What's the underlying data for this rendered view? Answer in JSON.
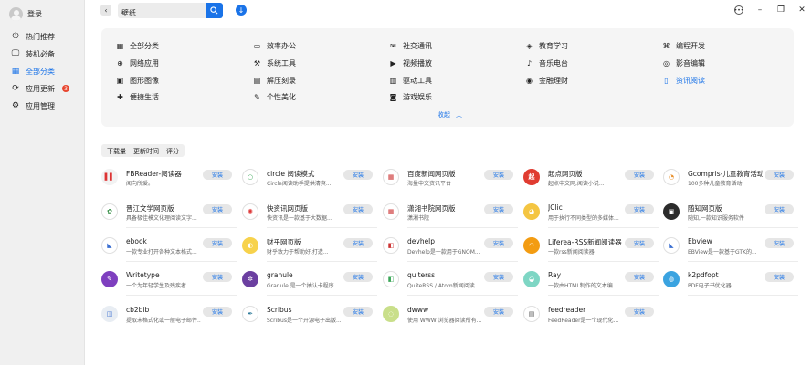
{
  "user": {
    "name": "登录"
  },
  "nav": [
    {
      "label": "热门推荐",
      "icon": "power-icon",
      "glyph": "⏻"
    },
    {
      "label": "装机必备",
      "icon": "monitor-icon",
      "glyph": "🖵"
    },
    {
      "label": "全部分类",
      "icon": "grid-icon",
      "glyph": "▦"
    },
    {
      "label": "应用更新",
      "icon": "refresh-icon",
      "glyph": "⟳",
      "badge": "3"
    },
    {
      "label": "应用管理",
      "icon": "settings-icon",
      "glyph": "⚙"
    }
  ],
  "search": {
    "value": "壁纸"
  },
  "categories": [
    {
      "label": "全部分类",
      "icon": "grid-icon",
      "glyph": "▦"
    },
    {
      "label": "效率办公",
      "icon": "briefcase-icon",
      "glyph": "▭"
    },
    {
      "label": "社交通讯",
      "icon": "chat-icon",
      "glyph": "✉"
    },
    {
      "label": "教育学习",
      "icon": "graduation-icon",
      "glyph": "◈"
    },
    {
      "label": "编程开发",
      "icon": "code-icon",
      "glyph": "⌘"
    },
    {
      "label": "网络应用",
      "icon": "globe-icon",
      "glyph": "⊕"
    },
    {
      "label": "系统工具",
      "icon": "tool-icon",
      "glyph": "⚒"
    },
    {
      "label": "视频播放",
      "icon": "video-icon",
      "glyph": "▶"
    },
    {
      "label": "音乐电台",
      "icon": "music-icon",
      "glyph": "♪"
    },
    {
      "label": "影音编辑",
      "icon": "media-edit-icon",
      "glyph": "◎"
    },
    {
      "label": "图形图像",
      "icon": "image-icon",
      "glyph": "▣"
    },
    {
      "label": "解压刻录",
      "icon": "archive-icon",
      "glyph": "▤"
    },
    {
      "label": "驱动工具",
      "icon": "driver-icon",
      "glyph": "▥"
    },
    {
      "label": "金融理财",
      "icon": "finance-icon",
      "glyph": "◉"
    },
    {
      "label": "资讯阅读",
      "icon": "book-icon",
      "glyph": "▯",
      "active": true
    },
    {
      "label": "便捷生活",
      "icon": "life-icon",
      "glyph": "✚"
    },
    {
      "label": "个性美化",
      "icon": "brush-icon",
      "glyph": "✎"
    },
    {
      "label": "游戏娱乐",
      "icon": "gamepad-icon",
      "glyph": "◙"
    }
  ],
  "collapse_label": "收起",
  "sort_tabs": [
    "下载量",
    "更新时间",
    "评分"
  ],
  "install_label": "安装",
  "apps": [
    {
      "name": "FBReader-阅读器",
      "desc": "阅向所爱。",
      "icon": "fbreader-icon",
      "color": "#f2f2f2",
      "fg": "#d33",
      "glyph": "▌▌"
    },
    {
      "name": "circle 阅读模式",
      "desc": "Circle阅读助手提供清爽...",
      "icon": "circle-icon",
      "color": "#ffffff",
      "fg": "#3aa657",
      "glyph": "○"
    },
    {
      "name": "百度新闻网页版",
      "desc": "海量中文资讯平台",
      "icon": "baidu-news-icon",
      "color": "#ffffff",
      "fg": "#c33",
      "glyph": "▦"
    },
    {
      "name": "起点网页版",
      "desc": "起点中文网,阅读小说...",
      "icon": "qidian-icon",
      "color": "#e03c31",
      "fg": "#fff",
      "glyph": "起"
    },
    {
      "name": "Gcompris-儿童教育活动",
      "desc": "100多种儿童教育活动",
      "icon": "gcompris-icon",
      "color": "#ffffff",
      "fg": "#e8902c",
      "glyph": "◔"
    },
    {
      "name": "晋江文学网页版",
      "desc": "具备极佳模文化理阅读文字...",
      "icon": "jinjiang-icon",
      "color": "#ffffff",
      "fg": "#2d8a3e",
      "glyph": "✿"
    },
    {
      "name": "快资讯网页版",
      "desc": "快资讯是一款基于大数据...",
      "icon": "kuaizixun-icon",
      "color": "#ffffff",
      "fg": "#d33",
      "glyph": "✺"
    },
    {
      "name": "潇湘书院网页版",
      "desc": "潇湘书院",
      "icon": "xiaoxiang-icon",
      "color": "#ffffff",
      "fg": "#c33",
      "glyph": "▦"
    },
    {
      "name": "JClic",
      "desc": "用于执行不同类型的多媒体...",
      "icon": "jclic-icon",
      "color": "#f4c542",
      "fg": "#fff",
      "glyph": "◕"
    },
    {
      "name": "随知网页版",
      "desc": "随知,一款知识服务软件",
      "icon": "suizhi-icon",
      "color": "#2b2b2b",
      "fg": "#fff",
      "glyph": "▣"
    },
    {
      "name": "ebook",
      "desc": "一款专业打开各种文本格式...",
      "icon": "ebook-icon",
      "color": "#ffffff",
      "fg": "#3b6fd1",
      "glyph": "◣"
    },
    {
      "name": "财乎网页版",
      "desc": "财乎致力于帮助好,打造...",
      "icon": "caihu-icon",
      "color": "#f7d24c",
      "fg": "#fff",
      "glyph": "◐"
    },
    {
      "name": "devhelp",
      "desc": "Devhelp是一款用于GNOM...",
      "icon": "devhelp-icon",
      "color": "#ffffff",
      "fg": "#c33",
      "glyph": "◧"
    },
    {
      "name": "Liferea-RSS新闻阅读器",
      "desc": "一款rss新闻阅读器",
      "icon": "liferea-icon",
      "color": "#f39c12",
      "fg": "#fff",
      "glyph": "◠"
    },
    {
      "name": "Ebview",
      "desc": "EBView是一款基于GTK的...",
      "icon": "ebview-icon",
      "color": "#ffffff",
      "fg": "#3b6fd1",
      "glyph": "◣"
    },
    {
      "name": "Writetype",
      "desc": "一个为年轻学生及残疾者...",
      "icon": "writetype-icon",
      "color": "#7e3fbf",
      "fg": "#fff",
      "glyph": "✎"
    },
    {
      "name": "granule",
      "desc": "Granule 是一个抽认卡程序",
      "icon": "granule-icon",
      "color": "#6b3fa0",
      "fg": "#fff",
      "glyph": "✲"
    },
    {
      "name": "quiterss",
      "desc": "QuiteRSS / Atom新闻阅读...",
      "icon": "quiterss-icon",
      "color": "#ffffff",
      "fg": "#3aa657",
      "glyph": "◧"
    },
    {
      "name": "Ray",
      "desc": "一款由HTML制作的文本编...",
      "icon": "ray-icon",
      "color": "#7ed6c4",
      "fg": "#fff",
      "glyph": "◒"
    },
    {
      "name": "k2pdfopt",
      "desc": "PDF电子书优化器",
      "icon": "k2pdfopt-icon",
      "color": "#3aa3e0",
      "fg": "#fff",
      "glyph": "◍"
    },
    {
      "name": "cb2bib",
      "desc": "提取未格式化或一般电子邮件...",
      "icon": "cb2bib-icon",
      "color": "#e8edf3",
      "fg": "#3b6fd1",
      "glyph": "◫"
    },
    {
      "name": "Scribus",
      "desc": "Scribus是一个开源电子出版...",
      "icon": "scribus-icon",
      "color": "#ffffff",
      "fg": "#2d7a9a",
      "glyph": "✒"
    },
    {
      "name": "dwww",
      "desc": "使用 WWW 浏览器阅读所有...",
      "icon": "dwww-icon",
      "color": "#c9df8a",
      "fg": "#fff",
      "glyph": "◌"
    },
    {
      "name": "feedreader",
      "desc": "FeedReader是一个现代化...",
      "icon": "feedreader-icon",
      "color": "#ffffff",
      "fg": "#555",
      "glyph": "▤"
    }
  ]
}
